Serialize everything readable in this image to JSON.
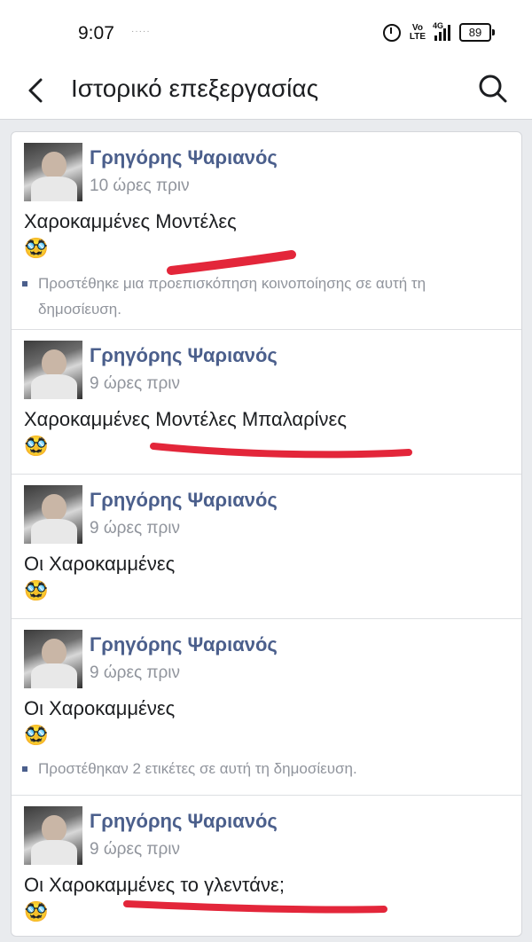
{
  "status_bar": {
    "time": "9:07",
    "dots": "·····",
    "volte": "Vo\nLTE",
    "network": "4G",
    "battery": "89"
  },
  "header": {
    "title": "Ιστορικό επεξεργασίας",
    "back_icon": "back-arrow-icon",
    "search_icon": "search-icon"
  },
  "colors": {
    "author": "#4b5f8c",
    "scribble": "#e3263a",
    "muted": "#90949c"
  },
  "entries": [
    {
      "author": "Γρηγόρης Ψαριανός",
      "time": "10 ώρες πριν",
      "text": "Χαροκαμμένες Μοντέλες",
      "emoji": "🥸",
      "note": "Προστέθηκε μια προεπισκόπηση κοινοποίησης σε αυτή τη δημοσίευση."
    },
    {
      "author": "Γρηγόρης Ψαριανός",
      "time": "9 ώρες πριν",
      "text": "Χαροκαμμένες Μοντέλες Μπαλαρίνες",
      "emoji": "🥸"
    },
    {
      "author": "Γρηγόρης Ψαριανός",
      "time": "9 ώρες πριν",
      "text": "Οι Χαροκαμμένες",
      "emoji": "🥸"
    },
    {
      "author": "Γρηγόρης Ψαριανός",
      "time": "9 ώρες πριν",
      "text": "Οι Χαροκαμμένες",
      "emoji": "🥸",
      "note": "Προστέθηκαν 2 ετικέτες σε αυτή τη δημοσίευση."
    },
    {
      "author": "Γρηγόρης Ψαριανός",
      "time": "9 ώρες πριν",
      "text": "Οι Χαροκαμμένες το γλεντάνε;",
      "emoji": "🥸"
    }
  ]
}
